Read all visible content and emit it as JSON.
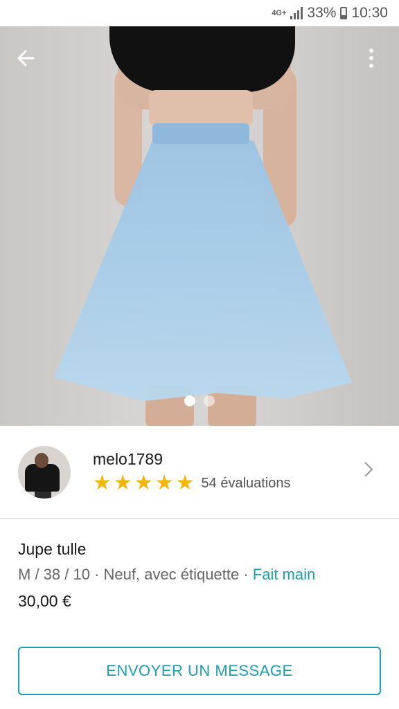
{
  "status_bar": {
    "network": "4G+",
    "battery": "33%",
    "time": "10:30"
  },
  "gallery": {
    "image_count": 2,
    "active_index": 0
  },
  "seller": {
    "username": "melo1789",
    "rating_stars": 5,
    "reviews_label": "54 évaluations"
  },
  "item": {
    "title": "Jupe tulle",
    "size": "M / 38 / 10",
    "separator": " · ",
    "condition": "Neuf, avec étiquette",
    "tag": "Fait main",
    "price": "30,00 €"
  },
  "actions": {
    "message_button": "ENVOYER UN MESSAGE"
  },
  "colors": {
    "accent": "#1a9fae",
    "star": "#f2b705"
  }
}
